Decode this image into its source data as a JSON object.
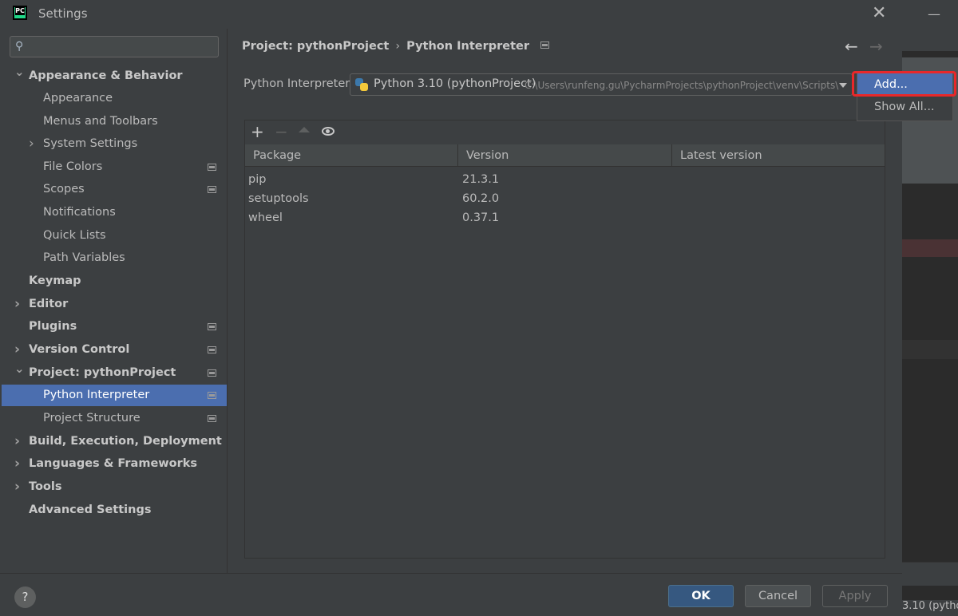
{
  "window": {
    "title": "Settings"
  },
  "background_ide": {
    "status_text": "3.10 (pytho"
  },
  "search": {
    "placeholder": "",
    "icon": "search-icon"
  },
  "sidebar": {
    "items": [
      {
        "label": "Appearance & Behavior",
        "expanded": true,
        "bold": true
      },
      {
        "label": "Appearance"
      },
      {
        "label": "Menus and Toolbars"
      },
      {
        "label": "System Settings",
        "collapsed": true
      },
      {
        "label": "File Colors",
        "project_icon": true
      },
      {
        "label": "Scopes",
        "project_icon": true
      },
      {
        "label": "Notifications"
      },
      {
        "label": "Quick Lists"
      },
      {
        "label": "Path Variables"
      },
      {
        "label": "Keymap",
        "bold": true
      },
      {
        "label": "Editor",
        "bold": true,
        "collapsed": true
      },
      {
        "label": "Plugins",
        "bold": true,
        "project_icon": true
      },
      {
        "label": "Version Control",
        "bold": true,
        "collapsed": true,
        "project_icon": true
      },
      {
        "label": "Project: pythonProject",
        "bold": true,
        "expanded": true,
        "project_icon": true
      },
      {
        "label": "Python Interpreter",
        "selected": true,
        "project_icon": true
      },
      {
        "label": "Project Structure",
        "project_icon": true
      },
      {
        "label": "Build, Execution, Deployment",
        "bold": true,
        "collapsed": true
      },
      {
        "label": "Languages & Frameworks",
        "bold": true,
        "collapsed": true
      },
      {
        "label": "Tools",
        "bold": true,
        "collapsed": true
      },
      {
        "label": "Advanced Settings",
        "bold": true
      }
    ]
  },
  "breadcrumb": {
    "part1": "Project: pythonProject",
    "separator": "›",
    "part2": "Python Interpreter"
  },
  "interpreter": {
    "label": "Python Interpreter:",
    "name": "Python 3.10 (pythonProject)",
    "path": "C:\\Users\\runfeng.gu\\PycharmProjects\\pythonProject\\venv\\Scripts\\"
  },
  "table": {
    "columns": [
      "Package",
      "Version",
      "Latest version"
    ],
    "rows": [
      {
        "package": "pip",
        "version": "21.3.1",
        "latest": ""
      },
      {
        "package": "setuptools",
        "version": "60.2.0",
        "latest": ""
      },
      {
        "package": "wheel",
        "version": "0.37.1",
        "latest": ""
      }
    ]
  },
  "popup": {
    "items": [
      "Add...",
      "Show All..."
    ],
    "selected": "Add..."
  },
  "buttons": {
    "ok": "OK",
    "cancel": "Cancel",
    "apply": "Apply",
    "help": "?"
  },
  "colors": {
    "selection": "#4b6eaf",
    "highlight_border": "#e8282a",
    "ok_button": "#365880"
  }
}
